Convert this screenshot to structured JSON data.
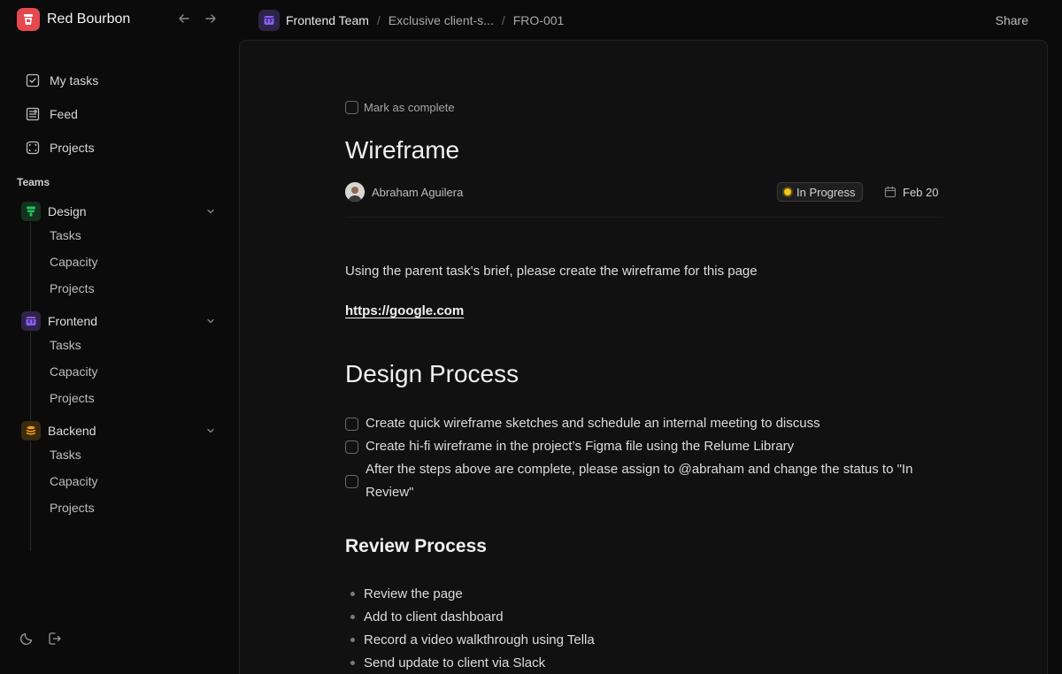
{
  "app": {
    "name": "Red Bourbon",
    "brand_color": "#e5484d"
  },
  "sidebar": {
    "main_nav": [
      {
        "label": "My tasks",
        "icon": "checkbox-icon"
      },
      {
        "label": "Feed",
        "icon": "feed-icon"
      },
      {
        "label": "Projects",
        "icon": "projects-icon"
      }
    ],
    "teams_label": "Teams",
    "teams": [
      {
        "name": "Design",
        "color": "#22c55e",
        "icon": "design-team-icon",
        "items": [
          "Tasks",
          "Capacity",
          "Projects"
        ]
      },
      {
        "name": "Frontend",
        "color": "#8b5cf6",
        "icon": "frontend-team-icon",
        "items": [
          "Tasks",
          "Capacity",
          "Projects"
        ]
      },
      {
        "name": "Backend",
        "color": "#f59e0b",
        "icon": "backend-team-icon",
        "items": [
          "Tasks",
          "Capacity",
          "Projects"
        ]
      }
    ]
  },
  "header": {
    "breadcrumb": [
      "Frontend Team",
      "Exclusive client-s...",
      "FRO-001"
    ],
    "share_label": "Share"
  },
  "task": {
    "mark_complete_label": "Mark as complete",
    "title": "Wireframe",
    "assignee": "Abraham Aguilera",
    "status": "In Progress",
    "status_color": "#f5c518",
    "due_date": "Feb 20",
    "description": "Using the parent task's brief, please create the wireframe for this page",
    "link": "https://google.com",
    "design_heading": "Design Process",
    "design_steps": [
      "Create quick wireframe sketches and schedule an internal meeting to discuss",
      "Create hi-fi wireframe in the project’s Figma file using the Relume Library",
      "After the steps above are complete, please assign to @abraham and change the status to \"In Review\""
    ],
    "review_heading": "Review Process",
    "review_steps": [
      "Review the page",
      "Add to client dashboard",
      "Record a video walkthrough using Tella",
      "Send update to client via Slack"
    ]
  }
}
